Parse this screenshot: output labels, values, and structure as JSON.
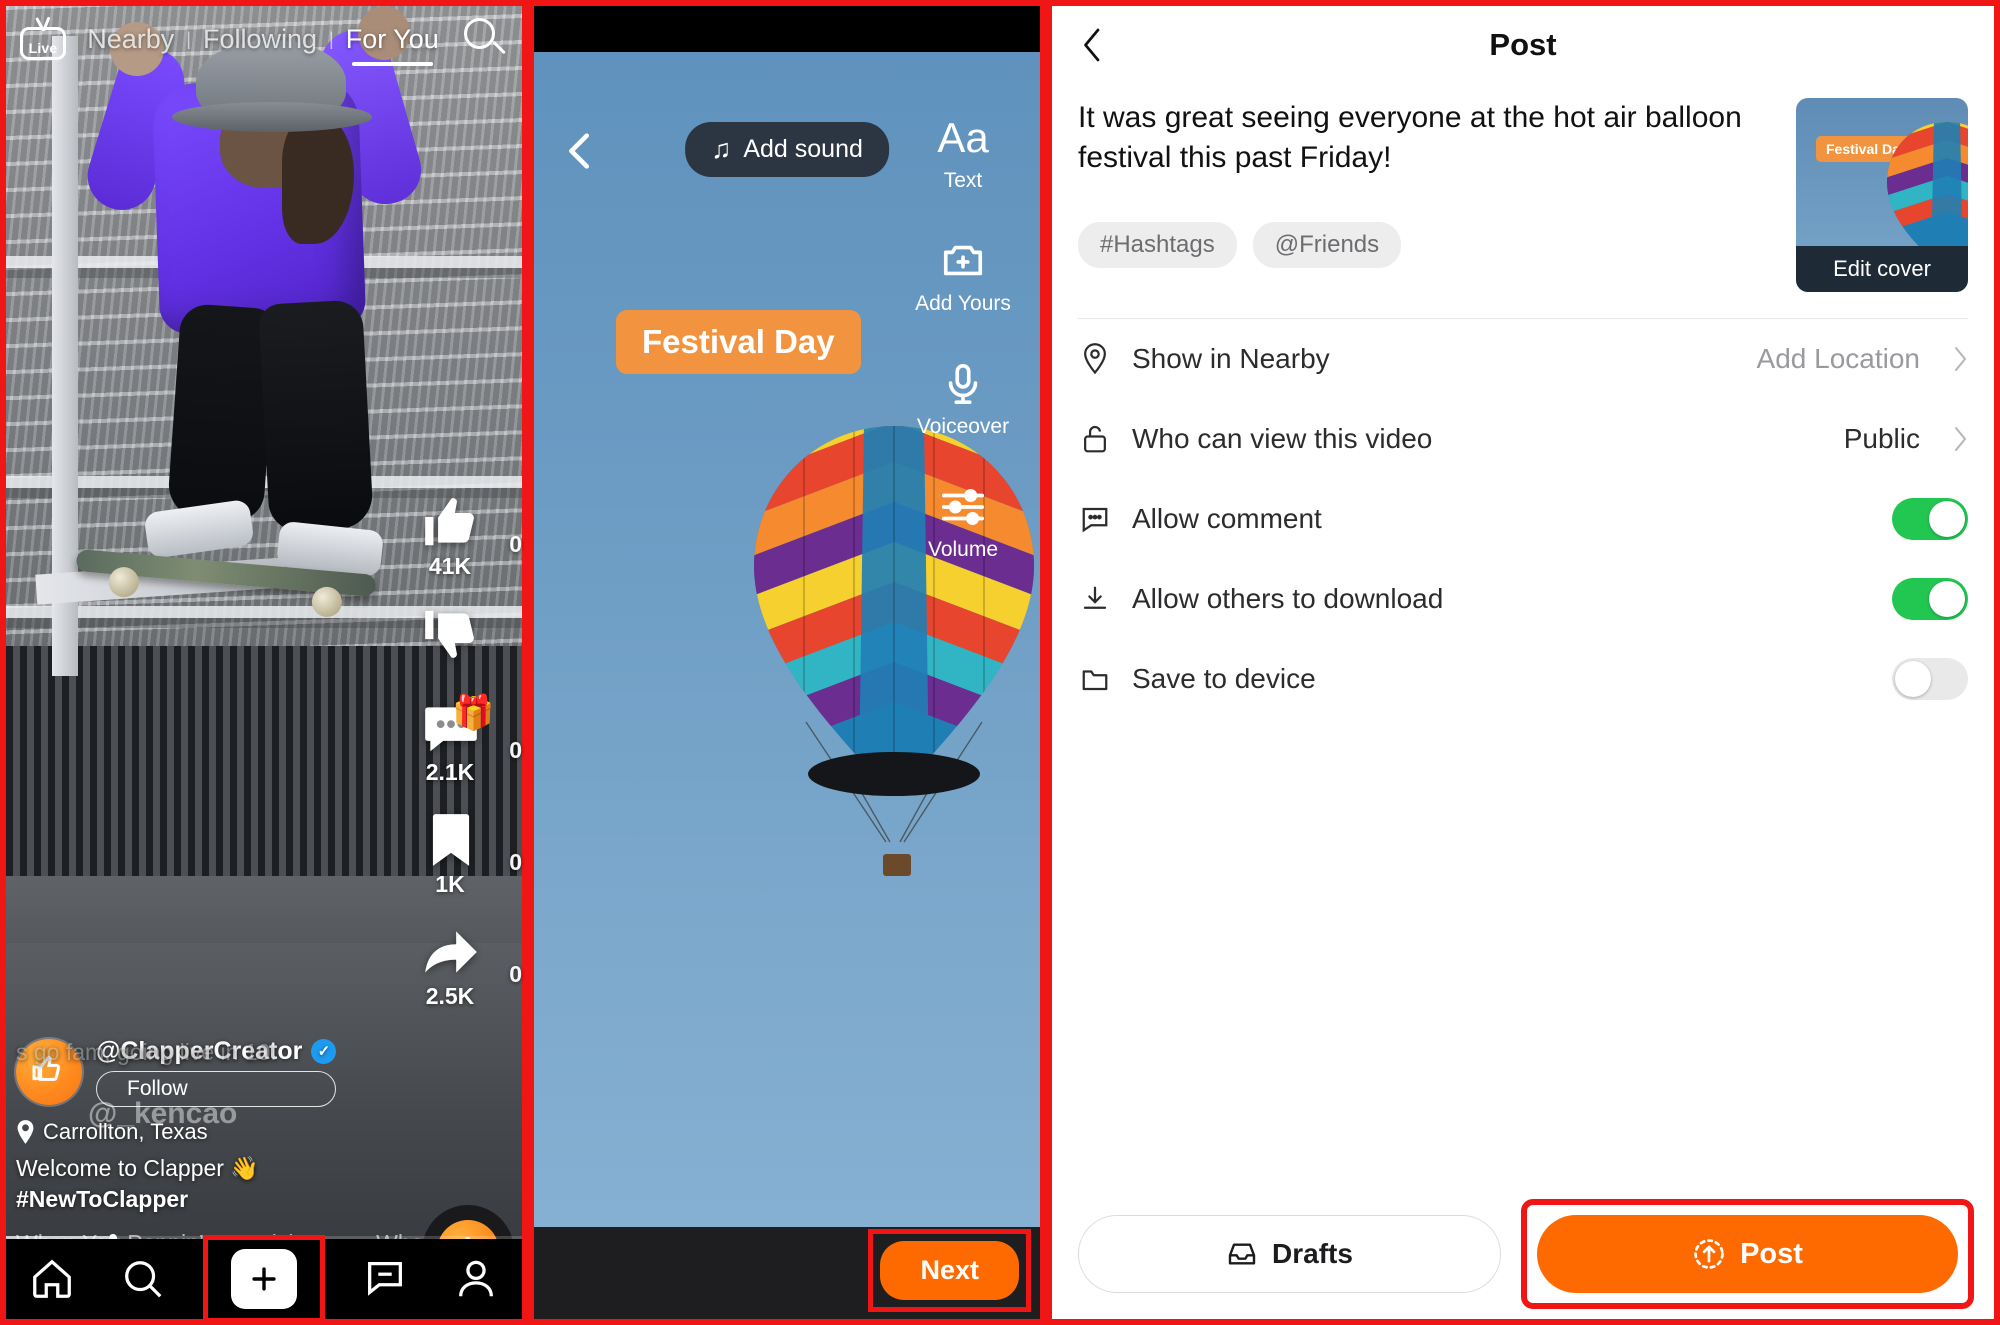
{
  "feed": {
    "live_label": "Live",
    "tabs": [
      {
        "label": "Nearby",
        "active": false
      },
      {
        "label": "Following",
        "active": false
      },
      {
        "label": "For You",
        "active": true
      }
    ],
    "tab_separator": "|",
    "actions": [
      {
        "name": "like",
        "count": "41K",
        "secondary": "0"
      },
      {
        "name": "dislike",
        "count": "",
        "secondary": ""
      },
      {
        "name": "comment",
        "count": "2.1K",
        "secondary": "0"
      },
      {
        "name": "bookmark",
        "count": "1K",
        "secondary": "0"
      },
      {
        "name": "share",
        "count": "2.5K",
        "secondary": "0"
      }
    ],
    "username": "@ClapperCreator",
    "ghost_username": "@_kencao",
    "follow_label": "Follow",
    "location": "Carrollton, Texas",
    "caption": "Welcome to Clapper 👋",
    "caption_ghost": "s go fam, going live in 10!",
    "hashtag": "#NewToClapper",
    "music": "When You Poppin’ - TJ Hickey",
    "music_ticker": "When You I",
    "nav": [
      {
        "name": "home",
        "label": "Home",
        "highlighted": false
      },
      {
        "name": "search",
        "label": "Search",
        "highlighted": false
      },
      {
        "name": "create",
        "label": "Create",
        "highlighted": true
      },
      {
        "name": "inbox",
        "label": "Inbox",
        "highlighted": false
      },
      {
        "name": "profile",
        "label": "Profile",
        "highlighted": false
      }
    ]
  },
  "editor": {
    "add_sound_label": "Add sound",
    "tools": [
      {
        "name": "text",
        "label": "Text",
        "glyph": "Aa"
      },
      {
        "name": "add-yours",
        "label": "Add Yours",
        "glyph": ""
      },
      {
        "name": "voiceover",
        "label": "Voiceover",
        "glyph": ""
      },
      {
        "name": "volume",
        "label": "Volume",
        "glyph": ""
      }
    ],
    "sticker_text": "Festival Day",
    "next_label": "Next",
    "sticker_color": "#F2943F",
    "next_color": "#FF6A00",
    "sky_color": "#6B9BC3"
  },
  "post": {
    "title": "Post",
    "caption": "It was great seeing everyone at the hot air balloon festival this past Friday!",
    "chips": [
      "#Hashtags",
      "@Friends"
    ],
    "thumbnail_sticker": "Festival Day",
    "edit_cover_label": "Edit cover",
    "settings": [
      {
        "name": "show-in-nearby",
        "label": "Show in Nearby",
        "value": "Add Location",
        "type": "chevron",
        "value_dark": false
      },
      {
        "name": "who-can-view",
        "label": "Who can view this video",
        "value": "Public",
        "type": "chevron",
        "value_dark": true
      },
      {
        "name": "allow-comment",
        "label": "Allow comment",
        "value": "on",
        "type": "toggle"
      },
      {
        "name": "allow-download",
        "label": "Allow others to download",
        "value": "on",
        "type": "toggle"
      },
      {
        "name": "save-to-device",
        "label": "Save to device",
        "value": "off",
        "type": "toggle"
      }
    ],
    "drafts_label": "Drafts",
    "post_label": "Post",
    "toggle_on_color": "#22C751",
    "post_button_color": "#FF6A00",
    "highlight_color": "#F01616"
  }
}
